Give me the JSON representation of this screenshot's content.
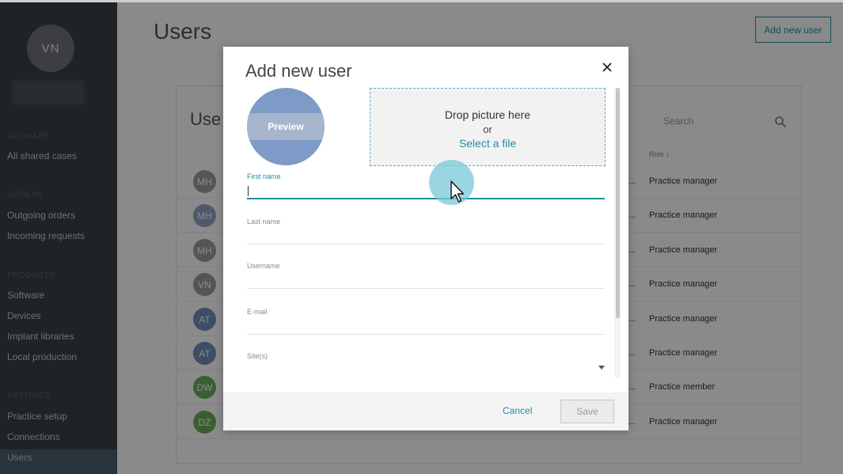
{
  "sidebar": {
    "user_initials": "VN",
    "sections": {
      "shared": "GOSHARE",
      "orders": "ORDERS",
      "products": "PRODUCTS",
      "settings": "SETTINGS"
    },
    "items": {
      "all_shared_cases": "All shared cases",
      "outgoing_orders": "Outgoing orders",
      "incoming_requests": "Incoming requests",
      "software": "Software",
      "devices": "Devices",
      "implant_libraries": "Implant libraries",
      "local_production": "Local production",
      "practice_setup": "Practice setup",
      "connections": "Connections",
      "users": "Users"
    }
  },
  "page": {
    "title": "Users",
    "add_button": "Add new user",
    "card_title": "Use",
    "search_placeholder": "Search",
    "role_header": "Role ↕"
  },
  "rows": [
    {
      "initials": "MH",
      "color": "#9e9e9e",
      "role": "Practice manager"
    },
    {
      "initials": "MH",
      "color": "#8fa6c9",
      "role": "Practice manager"
    },
    {
      "initials": "MH",
      "color": "#9e9e9e",
      "role": "Practice manager"
    },
    {
      "initials": "VN",
      "color": "#9e9e9e",
      "role": "Practice manager"
    },
    {
      "initials": "AT",
      "color": "#6f8fbd",
      "role": "Practice manager"
    },
    {
      "initials": "AT",
      "color": "#6f8fbd",
      "role": "Practice manager"
    },
    {
      "initials": "DW",
      "color": "#6cae5c",
      "role": "Practice member"
    },
    {
      "initials": "DZ",
      "color": "#6cae5c",
      "role": "Practice manager"
    }
  ],
  "row_ellipsis": "...",
  "modal": {
    "title": "Add new user",
    "preview_label": "Preview",
    "drop_line1": "Drop picture here",
    "drop_line2": "or",
    "select_file": "Select a file",
    "fields": {
      "first_name": {
        "label": "First name",
        "value": ""
      },
      "last_name": {
        "label": "Last name",
        "value": ""
      },
      "username": {
        "label": "Username",
        "value": ""
      },
      "email": {
        "label": "E-mail",
        "value": ""
      },
      "sites": {
        "label": "Site(s)",
        "value": ""
      }
    },
    "cancel": "Cancel",
    "save": "Save"
  },
  "colors": {
    "accent": "#1e8fa5",
    "sidebar_bg": "#3a4147"
  }
}
